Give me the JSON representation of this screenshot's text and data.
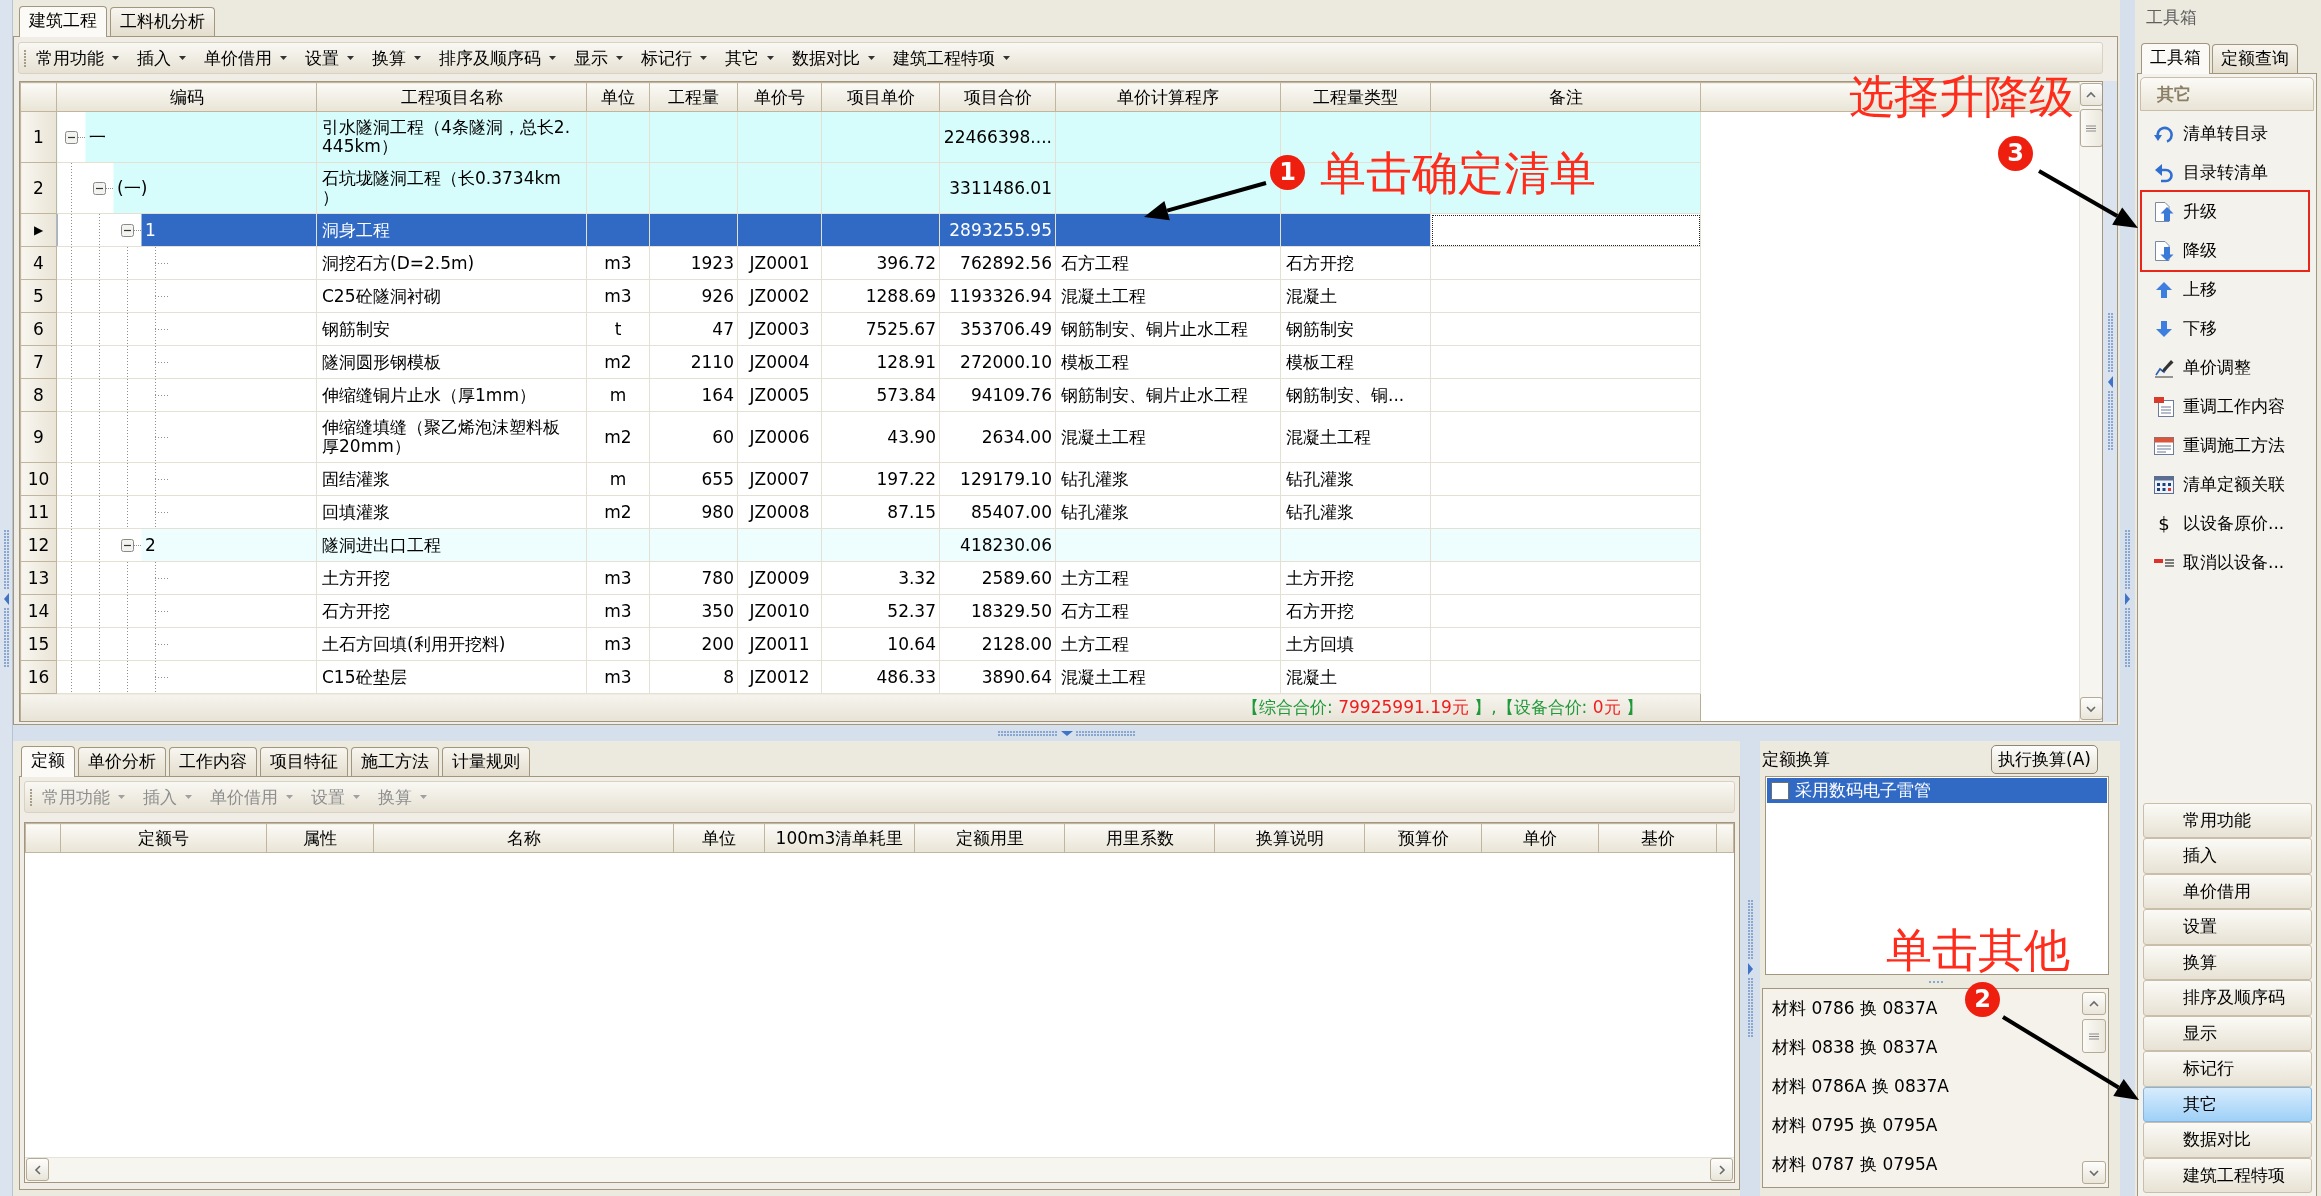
{
  "document_tabs": [
    {
      "label": "建筑工程",
      "selected": true
    },
    {
      "label": "工料机分析",
      "selected": false
    }
  ],
  "toolbar": [
    {
      "label": "常用功能",
      "disabled": false
    },
    {
      "label": "插入",
      "disabled": false
    },
    {
      "label": "单价借用",
      "disabled": false
    },
    {
      "label": "设置",
      "disabled": false
    },
    {
      "label": "换算",
      "disabled": false
    },
    {
      "label": "排序及顺序码",
      "disabled": false
    },
    {
      "label": "显示",
      "disabled": false
    },
    {
      "label": "标记行",
      "disabled": false
    },
    {
      "label": "其它",
      "disabled": false
    },
    {
      "label": "数据对比",
      "disabled": false
    },
    {
      "label": "建筑工程特项",
      "disabled": false
    }
  ],
  "bill_table": {
    "columns": [
      "编码",
      "工程项目名称",
      "单位",
      "工程量",
      "单价号",
      "项目单价",
      "项目合价",
      "单价计算程序",
      "工程量类型",
      "备注"
    ],
    "rows": [
      {
        "row_label": "1",
        "code": "一",
        "name": "引水隧洞工程（4条隧洞，总长2.445km）",
        "total": "22466398....",
        "selected": false,
        "expanded": true,
        "children": [
          {
            "row_label": "2",
            "code": "(一)",
            "name": "石坑垅隧洞工程（长0.3734km）",
            "total": "3311486.01",
            "selected": false,
            "expanded": true,
            "children": [
              {
                "row_label": "▶",
                "code": "1",
                "name": "洞身工程",
                "total": "2893255.95",
                "selected": true,
                "expanded": true,
                "children": [
                  {
                    "row_label": "4",
                    "name": "洞挖石方(D=2.5m)",
                    "unit": "m3",
                    "quantity": "1923",
                    "price_code": "JZ0001",
                    "unit_price": "396.72",
                    "total": "762892.56",
                    "program": "石方工程",
                    "quantity_type": "石方开挖",
                    "selected": false
                  },
                  {
                    "row_label": "5",
                    "name": "C25砼隧洞衬砌",
                    "unit": "m3",
                    "quantity": "926",
                    "price_code": "JZ0002",
                    "unit_price": "1288.69",
                    "total": "1193326.94",
                    "program": "混凝土工程",
                    "quantity_type": "混凝土",
                    "selected": false
                  },
                  {
                    "row_label": "6",
                    "name": "钢筋制安",
                    "unit": "t",
                    "quantity": "47",
                    "price_code": "JZ0003",
                    "unit_price": "7525.67",
                    "total": "353706.49",
                    "program": "钢筋制安、铜片止水工程",
                    "quantity_type": "钢筋制安",
                    "selected": false
                  },
                  {
                    "row_label": "7",
                    "name": "隧洞圆形钢模板",
                    "unit": "m2",
                    "quantity": "2110",
                    "price_code": "JZ0004",
                    "unit_price": "128.91",
                    "total": "272000.10",
                    "program": "模板工程",
                    "quantity_type": "模板工程",
                    "selected": false
                  },
                  {
                    "row_label": "8",
                    "name": "伸缩缝铜片止水（厚1mm）",
                    "unit": "m",
                    "quantity": "164",
                    "price_code": "JZ0005",
                    "unit_price": "573.84",
                    "total": "94109.76",
                    "program": "钢筋制安、铜片止水工程",
                    "quantity_type": "钢筋制安、铜...",
                    "selected": false
                  },
                  {
                    "row_label": "9",
                    "name": "伸缩缝填缝（聚乙烯泡沫塑料板厚20mm）",
                    "unit": "m2",
                    "quantity": "60",
                    "price_code": "JZ0006",
                    "unit_price": "43.90",
                    "total": "2634.00",
                    "program": "混凝土工程",
                    "quantity_type": "混凝土工程",
                    "selected": false
                  },
                  {
                    "row_label": "10",
                    "name": "固结灌浆",
                    "unit": "m",
                    "quantity": "655",
                    "price_code": "JZ0007",
                    "unit_price": "197.22",
                    "total": "129179.10",
                    "program": "钻孔灌浆",
                    "quantity_type": "钻孔灌浆",
                    "selected": false
                  },
                  {
                    "row_label": "11",
                    "name": "回填灌浆",
                    "unit": "m2",
                    "quantity": "980",
                    "price_code": "JZ0008",
                    "unit_price": "87.15",
                    "total": "85407.00",
                    "program": "钻孔灌浆",
                    "quantity_type": "钻孔灌浆",
                    "selected": false
                  }
                ]
              },
              {
                "row_label": "12",
                "code": "2",
                "name": "隧洞进出口工程",
                "total": "418230.06",
                "selected": false,
                "expanded": true,
                "children": [
                  {
                    "row_label": "13",
                    "name": "土方开挖",
                    "unit": "m3",
                    "quantity": "780",
                    "price_code": "JZ0009",
                    "unit_price": "3.32",
                    "total": "2589.60",
                    "program": "土方工程",
                    "quantity_type": "土方开挖",
                    "selected": false
                  },
                  {
                    "row_label": "14",
                    "name": "石方开挖",
                    "unit": "m3",
                    "quantity": "350",
                    "price_code": "JZ0010",
                    "unit_price": "52.37",
                    "total": "18329.50",
                    "program": "石方工程",
                    "quantity_type": "石方开挖",
                    "selected": false
                  },
                  {
                    "row_label": "15",
                    "name": "土石方回填(利用开挖料)",
                    "unit": "m3",
                    "quantity": "200",
                    "price_code": "JZ0011",
                    "unit_price": "10.64",
                    "total": "2128.00",
                    "program": "土方工程",
                    "quantity_type": "土方回填",
                    "selected": false
                  },
                  {
                    "row_label": "16",
                    "name": "C15砼垫层",
                    "unit": "m3",
                    "quantity": "8",
                    "price_code": "JZ0012",
                    "unit_price": "486.33",
                    "total": "3890.64",
                    "program": "混凝土工程",
                    "quantity_type": "混凝土",
                    "selected": false
                  }
                ]
              }
            ]
          }
        ]
      }
    ],
    "summary": [
      {
        "kind": "label",
        "text": "【综合合价: "
      },
      {
        "kind": "value",
        "text": "79925991.19元"
      },
      {
        "kind": "label",
        "text": " 】,【设备合价: "
      },
      {
        "kind": "value",
        "text": "0元"
      },
      {
        "kind": "label",
        "text": " 】"
      }
    ]
  },
  "detail_tabs": [
    {
      "label": "定额",
      "selected": true
    },
    {
      "label": "单价分析",
      "selected": false
    },
    {
      "label": "工作内容",
      "selected": false
    },
    {
      "label": "项目特征",
      "selected": false
    },
    {
      "label": "施工方法",
      "selected": false
    },
    {
      "label": "计量规则",
      "selected": false
    }
  ],
  "detail_toolbar": [
    {
      "label": "常用功能",
      "disabled": true
    },
    {
      "label": "插入",
      "disabled": true
    },
    {
      "label": "单价借用",
      "disabled": true
    },
    {
      "label": "设置",
      "disabled": true
    },
    {
      "label": "换算",
      "disabled": true
    }
  ],
  "quota_table": {
    "columns": [
      "定额号",
      "属性",
      "名称",
      "单位",
      "100m3清单耗里",
      "定额用里",
      "用里系数",
      "换算说明",
      "预算价",
      "单价",
      "基价"
    ]
  },
  "quota_conversion": {
    "title": "定额换算",
    "button": "执行换算(A)",
    "options": [
      {
        "label": "采用数码电子雷管",
        "checked": false,
        "selected": true
      }
    ],
    "materials": [
      "材料 0786 换 0837A",
      "材料 0838 换 0837A",
      "材料 0786A 换 0837A",
      "材料 0795 换 0795A",
      "材料 0787 换 0795A"
    ]
  },
  "toolbox": {
    "title": "工具箱",
    "tabs": [
      {
        "label": "工具箱",
        "selected": true
      },
      {
        "label": "定额查询",
        "selected": false
      }
    ],
    "section": "其它",
    "items": [
      {
        "label": "清单转目录",
        "highlighted": false
      },
      {
        "label": "目录转清单",
        "highlighted": false
      },
      {
        "label": "升级",
        "highlighted": true
      },
      {
        "label": "降级",
        "highlighted": true
      },
      {
        "label": "上移",
        "highlighted": false
      },
      {
        "label": "下移",
        "highlighted": false
      },
      {
        "label": "单价调整",
        "highlighted": false
      },
      {
        "label": "重调工作内容",
        "highlighted": false
      },
      {
        "label": "重调施工方法",
        "highlighted": false
      },
      {
        "label": "清单定额关联",
        "highlighted": false
      },
      {
        "glyph": "$",
        "label": "以设备原价...",
        "highlighted": false
      },
      {
        "label": "取消以设备...",
        "highlighted": false
      }
    ],
    "categories": [
      {
        "label": "常用功能",
        "selected": false
      },
      {
        "label": "插入",
        "selected": false
      },
      {
        "label": "单价借用",
        "selected": false
      },
      {
        "label": "设置",
        "selected": false
      },
      {
        "label": "换算",
        "selected": false
      },
      {
        "label": "排序及顺序码",
        "selected": false
      },
      {
        "label": "显示",
        "selected": false
      },
      {
        "label": "标记行",
        "selected": false
      },
      {
        "label": "其它",
        "selected": true
      },
      {
        "label": "数据对比",
        "selected": false
      },
      {
        "label": "建筑工程特项",
        "selected": false
      }
    ]
  },
  "annotations": [
    {
      "number": "3",
      "caption": "选择升降级"
    },
    {
      "number": "1",
      "caption": "单击确定清单"
    },
    {
      "number": "2",
      "caption": "单击其他"
    }
  ]
}
